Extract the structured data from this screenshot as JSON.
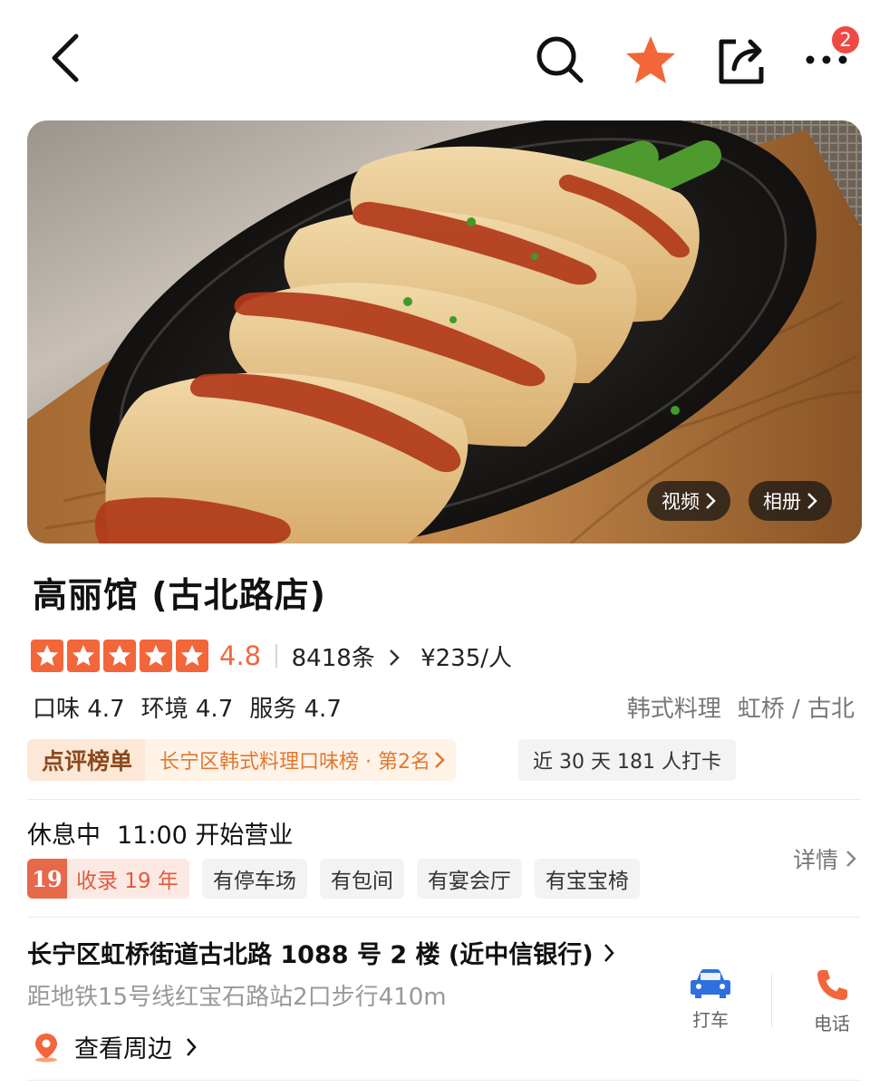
{
  "header": {
    "back_icon": "chevron-left-icon",
    "search_icon": "search-icon",
    "favorite_icon": "star-icon",
    "share_icon": "share-icon",
    "more_icon": "more-dots-icon",
    "notification_count": "2",
    "accent_color": "#f2663a"
  },
  "hero": {
    "video_label": "视频",
    "album_label": "相册"
  },
  "store": {
    "name": "高丽馆 (古北路店)",
    "stars": 5,
    "score": "4.8",
    "review_count": "8418条",
    "price": "¥235/人",
    "sub_scores": [
      "口味 4.7",
      "环境 4.7",
      "服务 4.7"
    ],
    "category": "韩式料理",
    "area": "虹桥 / 古北"
  },
  "ranking": {
    "badge_label": "点评榜单",
    "rank_text": "长宁区韩式料理口味榜 · 第2名",
    "checkin_text": "近 30 天 181 人打卡"
  },
  "hours": {
    "status": "休息中",
    "open_text": "11:00 开始营业",
    "detail_label": "详情"
  },
  "tags": {
    "years_number": "19",
    "years_text": "收录 19 年",
    "items": [
      "有停车场",
      "有包间",
      "有宴会厅",
      "有宝宝椅"
    ]
  },
  "location": {
    "address": "长宁区虹桥街道古北路 1088 号 2 楼 (近中信银行)",
    "metro": "距地铁15号线红宝石路站2口步行410m",
    "nearby_label": "查看周边"
  },
  "actions": {
    "taxi_label": "打车",
    "phone_label": "电话",
    "taxi_color": "#2f6fe0",
    "phone_color": "#f2663a"
  }
}
